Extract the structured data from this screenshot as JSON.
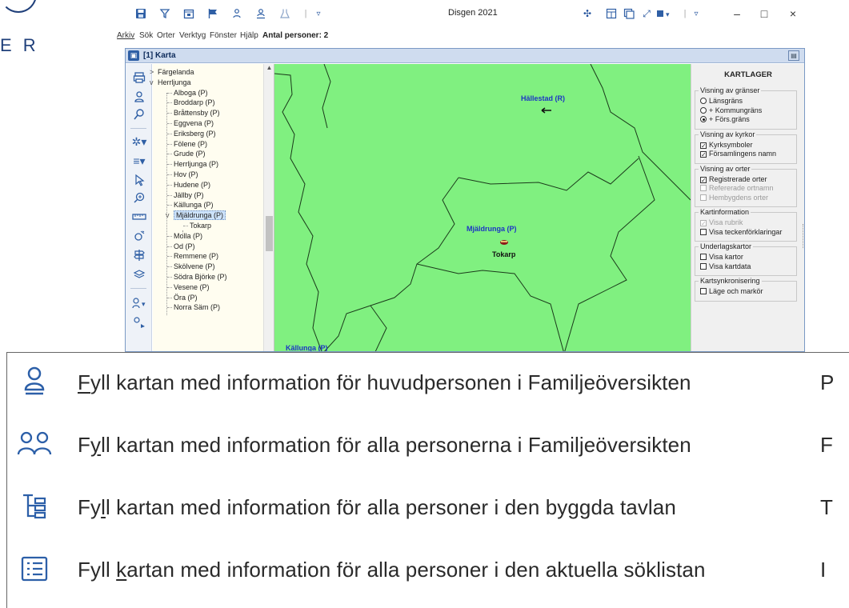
{
  "background": {
    "logo_letters": "E R"
  },
  "window": {
    "title": "Disgen 2021",
    "quick_access_icons": [
      "disk-icon",
      "funnel-icon",
      "calendar-icon",
      "flag-icon",
      "person-up-icon",
      "person-pin-icon",
      "flask-icon"
    ],
    "controls": {
      "minimize": "–",
      "maximize": "□",
      "close": "×"
    }
  },
  "menu": {
    "items": [
      {
        "label": "Arkiv",
        "hotkey_index": 0
      },
      {
        "label": "Sök"
      },
      {
        "label": "Orter",
        "hotkey_index": 0
      },
      {
        "label": "Verktyg"
      },
      {
        "label": "Fönster",
        "hotkey_index": 0
      },
      {
        "label": "Hjälp",
        "hotkey_index": 0
      }
    ],
    "status": "Antal personer: 2"
  },
  "karta": {
    "title": "[1] Karta",
    "tree": {
      "items": [
        {
          "label": "Färgelanda",
          "level": 0,
          "twisty": ">"
        },
        {
          "label": "Herrljunga",
          "level": 0,
          "twisty": "v"
        },
        {
          "label": "Alboga (P)",
          "level": 1
        },
        {
          "label": "Broddarp (P)",
          "level": 1
        },
        {
          "label": "Bråttensby (P)",
          "level": 1
        },
        {
          "label": "Eggvena (P)",
          "level": 1
        },
        {
          "label": "Eriksberg (P)",
          "level": 1
        },
        {
          "label": "Fölene (P)",
          "level": 1
        },
        {
          "label": "Grude (P)",
          "level": 1
        },
        {
          "label": "Herrljunga (P)",
          "level": 1
        },
        {
          "label": "Hov (P)",
          "level": 1
        },
        {
          "label": "Hudene (P)",
          "level": 1
        },
        {
          "label": "Jällby (P)",
          "level": 1
        },
        {
          "label": "Källunga (P)",
          "level": 1
        },
        {
          "label": "Mjäldrunga (P)",
          "level": 1,
          "twisty": "v",
          "selected": true
        },
        {
          "label": "Tokarp",
          "level": 2
        },
        {
          "label": "Molla (P)",
          "level": 1
        },
        {
          "label": "Od (P)",
          "level": 1
        },
        {
          "label": "Remmene (P)",
          "level": 1
        },
        {
          "label": "Skölvene (P)",
          "level": 1
        },
        {
          "label": "Södra Björke (P)",
          "level": 1
        },
        {
          "label": "Vesene (P)",
          "level": 1
        },
        {
          "label": "Öra (P)",
          "level": 1
        },
        {
          "label": "Norra Säm (P)",
          "level": 1
        }
      ]
    },
    "map": {
      "fill_color": "#80f080",
      "labels": [
        {
          "text": "Hällestad (R)",
          "color": "blue"
        },
        {
          "text": "Mjäldrunga (P)",
          "color": "blue"
        },
        {
          "text": "Tokarp",
          "color": "black"
        },
        {
          "text": "Källunga (P)",
          "color": "blue"
        }
      ]
    },
    "kartlager": {
      "title": "KARTLAGER",
      "groups": [
        {
          "title": "Visning av gränser",
          "options": [
            {
              "type": "radio",
              "label": "Länsgräns",
              "checked": false
            },
            {
              "type": "radio",
              "label": "+ Kommungräns",
              "checked": false
            },
            {
              "type": "radio",
              "label": "+ Förs.gräns",
              "checked": true
            }
          ]
        },
        {
          "title": "Visning av kyrkor",
          "options": [
            {
              "type": "check",
              "label": "Kyrksymboler",
              "checked": true
            },
            {
              "type": "check",
              "label": "Församlingens namn",
              "checked": true
            }
          ]
        },
        {
          "title": "Visning av orter",
          "options": [
            {
              "type": "check",
              "label": "Registrerade orter",
              "checked": true
            },
            {
              "type": "check",
              "label": "Refererade ortnamn",
              "checked": false,
              "disabled": true
            },
            {
              "type": "check",
              "label": "Hembygdens orter",
              "checked": false,
              "disabled": true
            }
          ]
        },
        {
          "title": "Kartinformation",
          "options": [
            {
              "type": "check",
              "label": "Visa rubrik",
              "checked": true,
              "disabled": true
            },
            {
              "type": "check",
              "label": "Visa teckenförklaringar",
              "checked": false
            }
          ]
        },
        {
          "title": "Underlagskartor",
          "options": [
            {
              "type": "check",
              "label": "Visa kartor",
              "checked": false
            },
            {
              "type": "check",
              "label": "Visa kartdata",
              "checked": false
            }
          ]
        },
        {
          "title": "Kartsynkronisering",
          "options": [
            {
              "type": "check",
              "label": "Läge och markör",
              "checked": false
            }
          ]
        }
      ]
    }
  },
  "context_menu": {
    "items": [
      {
        "pre": "",
        "u": "F",
        "post": "yll kartan med information för huvudpersonen i Familjeöversikten",
        "shortcut": "P",
        "icon": "person-icon"
      },
      {
        "pre": "F",
        "u": "y",
        "post": "ll kartan med information för alla personerna i Familjeöversikten",
        "shortcut": "F",
        "icon": "persons-icon"
      },
      {
        "pre": "Fy",
        "u": "l",
        "post": "l kartan med information för alla personer i den byggda tavlan",
        "shortcut": "T",
        "icon": "tree-board-icon"
      },
      {
        "pre": "Fyll ",
        "u": "k",
        "post": "artan med information för alla personer i den aktuella söklistan",
        "shortcut": "I",
        "icon": "list-icon"
      }
    ]
  }
}
